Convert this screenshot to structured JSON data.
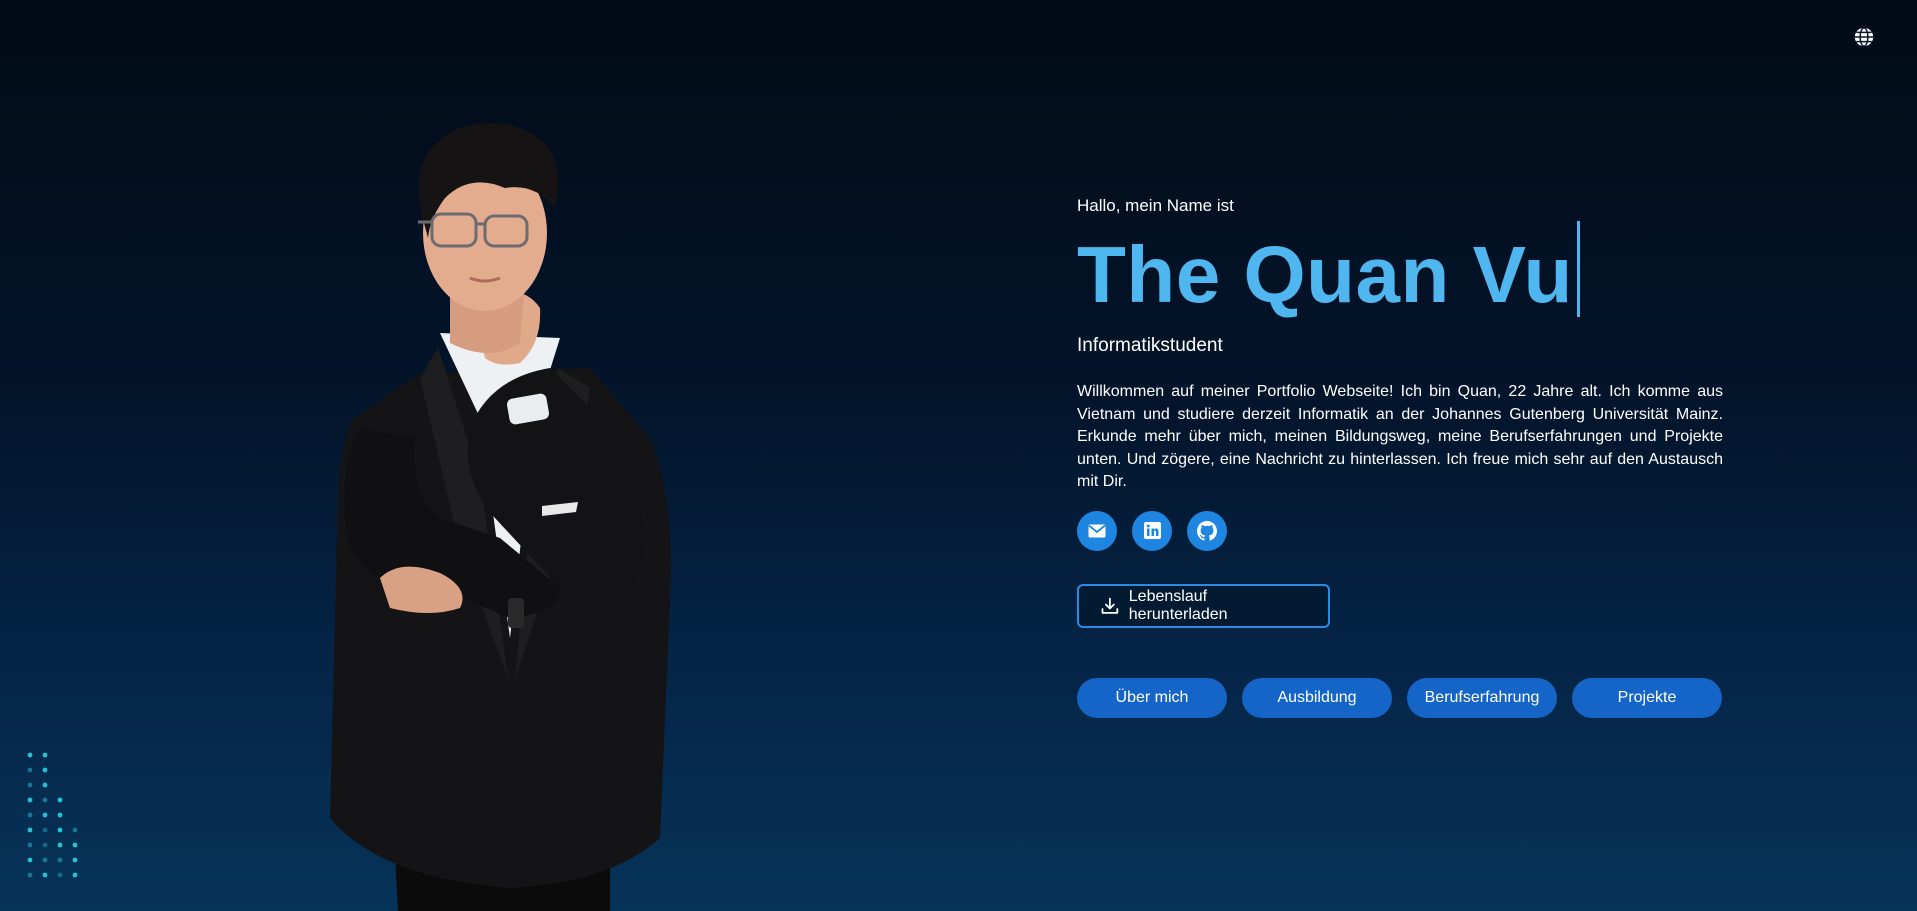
{
  "header": {
    "language_icon": "globe-icon"
  },
  "hero": {
    "greeting": "Hallo, mein Name ist",
    "name": "The Quan Vu",
    "role": "Informatikstudent",
    "bio": "Willkommen auf meiner Portfolio Webseite! Ich bin Quan, 22 Jahre alt. Ich komme aus Vietnam und studiere derzeit Informatik an der Johannes Gutenberg Universität Mainz. Erkunde mehr über mich, meinen Bildungsweg, meine Berufserfahrungen und Projekte unten. Und zögere, eine Nachricht zu hinterlassen. Ich freue mich sehr auf den Austausch mit Dir.",
    "socials": [
      {
        "icon": "mail-icon"
      },
      {
        "icon": "linkedin-icon"
      },
      {
        "icon": "github-icon"
      }
    ],
    "cv_button": {
      "label": "Lebenslauf herunterladen",
      "icon": "download-icon"
    },
    "nav": [
      {
        "label": "Über mich"
      },
      {
        "label": "Ausbildung"
      },
      {
        "label": "Berufserfahrung"
      },
      {
        "label": "Projekte"
      }
    ]
  },
  "colors": {
    "accent": "#4fb6ef",
    "button": "#1565c8",
    "social": "#1e86e0",
    "background_top": "#020b16",
    "background_bottom": "#063358"
  }
}
